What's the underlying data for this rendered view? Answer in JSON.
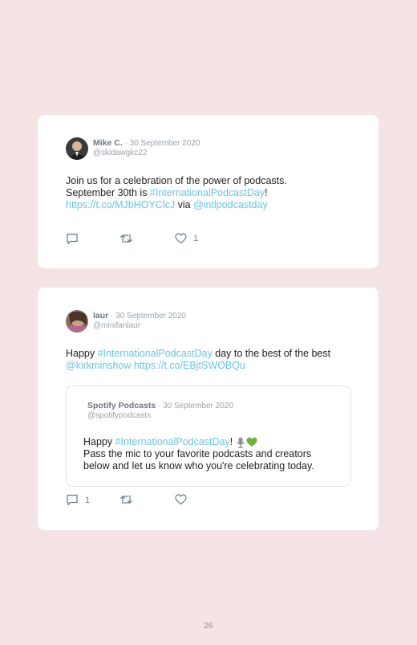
{
  "tweets": [
    {
      "author": "Mike C.",
      "date": " · 30 September 2020",
      "handle": "@skidawgkc22",
      "text": {
        "line1": "Join us for a celebration of the power of podcasts.",
        "line2_pre": "September 30th is ",
        "line2_hashtag": "#InternationalPodcastDay",
        "line2_post": "!",
        "line3_link": "https://t.co/MJbHOYClcJ",
        "line3_mid": " via ",
        "line3_mention": "@intlpodcastday"
      },
      "reply_count": "",
      "like_count": "1"
    },
    {
      "author": "laur",
      "date": " · 30 September 2020",
      "handle": "@minifanlaur",
      "text": {
        "line1_pre": "Happy ",
        "line1_hashtag": "#InternationalPodcastDay",
        "line1_post": " day to the best of the best",
        "line2_mention": "@kirkminshow",
        "line2_link": " https://t.co/EBjtSWOBQu"
      },
      "reply_count": "1",
      "like_count": "",
      "quoted": {
        "author": "Spotify Podcasts",
        "date": " · 30 September 2020",
        "handle": "@spotifypodcasts",
        "text": {
          "line1_pre": "Happy ",
          "line1_hashtag": "#InternationalPodcastDay",
          "line1_post": "! ",
          "line2": "Pass the mic to your favorite podcasts and creators",
          "line3": "below and let us know who you're celebrating today."
        }
      }
    }
  ],
  "page_number": "26",
  "colors": {
    "background": "#f5e4e5",
    "link": "#6bc4e6",
    "icon": "#6a7a8a"
  },
  "icons": [
    "reply-icon",
    "retweet-icon",
    "like-icon",
    "microphone-emoji",
    "green-heart-emoji"
  ]
}
